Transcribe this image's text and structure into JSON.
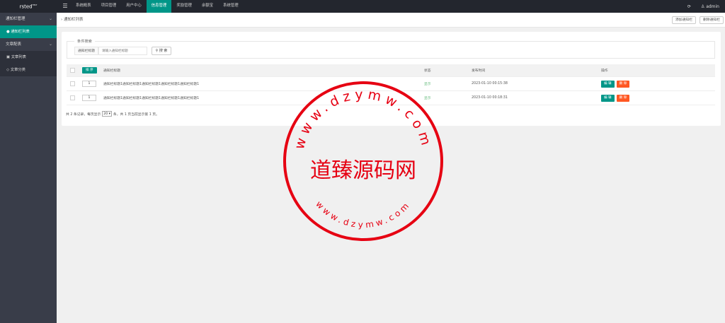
{
  "app": {
    "logo_text": "rsted",
    "logo_sup": "TPLT"
  },
  "topnav": {
    "menu_icon": "hamburger-icon",
    "items": [
      {
        "label": "系统概表"
      },
      {
        "label": "项目管理"
      },
      {
        "label": "用户中心"
      },
      {
        "label": "信息管理",
        "active": true
      },
      {
        "label": "奖励管理"
      },
      {
        "label": "余额宝"
      },
      {
        "label": "系统管理"
      }
    ],
    "refresh_icon": "refresh-icon",
    "user_label": "admin"
  },
  "sidebar": {
    "groups": [
      {
        "label": "通知栏管理",
        "items": [
          {
            "label": "通知栏列表",
            "active": true
          }
        ]
      },
      {
        "label": "文章配表",
        "items": [
          {
            "label": "文章列表"
          },
          {
            "label": "文章分类"
          }
        ]
      }
    ]
  },
  "breadcrumb": "通知栏列表",
  "toolbar": {
    "add_label": "添加通知栏",
    "delete_label": "删除通知栏"
  },
  "search": {
    "legend": "条件搜索",
    "field_label": "通知栏标题",
    "placeholder": "请输入通知栏标题",
    "button_label": "搜 索"
  },
  "table": {
    "sort_button": "排 序",
    "headers": [
      "通知栏标题",
      "状态",
      "发布时间",
      "操作"
    ],
    "rows": [
      {
        "order": "1",
        "title": "通知栏标题1通知栏标题1通知栏标题1通知栏标题1通知栏标题1",
        "status": "显示",
        "time": "2023-01-10 00:15:38"
      },
      {
        "order": "1",
        "title": "通知栏标题1通知栏标题1通知栏标题1通知栏标题1通知栏标题1",
        "status": "显示",
        "time": "2023-01-10 00:18:31"
      }
    ],
    "edit_label": "编 辑",
    "delete_label": "删 除"
  },
  "pager": {
    "prefix": "共 2 条记录，每页显示",
    "page_size": "20",
    "suffix": "条，共 1 页当前显示第 1 页。"
  },
  "watermark": {
    "top_text": "www.dzymw.com",
    "center_text": "道臻源码网",
    "bottom_text": "www.dzymw.com",
    "color": "#e60012"
  },
  "colors": {
    "accent": "#009688",
    "danger": "#ff5722",
    "topbar": "#23262e",
    "sidebar": "#393d49"
  }
}
